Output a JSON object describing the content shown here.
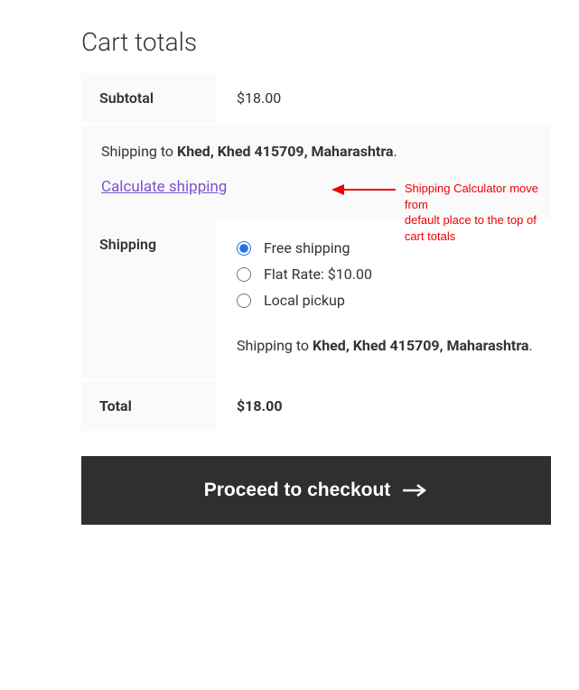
{
  "heading": "Cart totals",
  "subtotal": {
    "label": "Subtotal",
    "value": "$18.00"
  },
  "calculator_block": {
    "shipping_to_prefix": "Shipping to ",
    "destination": "Khed, Khed 415709, Maharashtra",
    "suffix": ".",
    "calc_link": "Calculate shipping"
  },
  "annotation": {
    "line1": "Shipping Calculator move from",
    "line2": "default place to the top of cart totals"
  },
  "shipping": {
    "label": "Shipping",
    "options": [
      {
        "label": "Free shipping",
        "checked": true
      },
      {
        "label": "Flat Rate: ",
        "price": "$10.00",
        "checked": false
      },
      {
        "label": "Local pickup",
        "checked": false
      }
    ],
    "shipping_to_prefix": "Shipping to ",
    "destination": "Khed, Khed 415709, Maharashtra",
    "suffix": "."
  },
  "total": {
    "label": "Total",
    "value": "$18.00"
  },
  "checkout_button": "Proceed to checkout"
}
